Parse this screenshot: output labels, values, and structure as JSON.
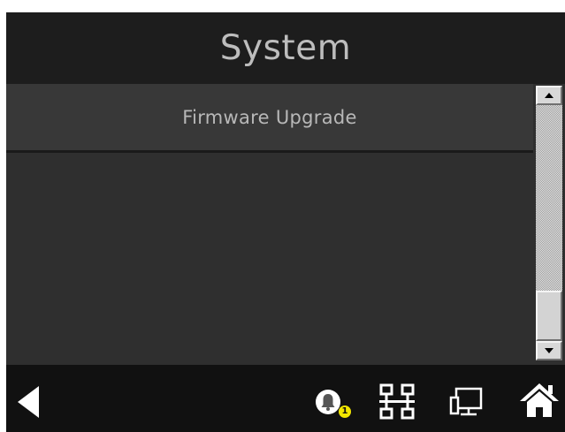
{
  "header": {
    "title": "System"
  },
  "list": {
    "items": [
      {
        "label": "Firmware Upgrade"
      }
    ]
  },
  "bottom_bar": {
    "alarm_badge_count": "1",
    "icons": [
      "back-arrow-icon",
      "alarm-bell-icon",
      "network-icon",
      "monitor-icon",
      "home-icon"
    ]
  },
  "colors": {
    "title_bar": "#1d1d1d",
    "content_background": "#2f2f2f",
    "list_item_background": "#383838",
    "bottom_bar": "#111111",
    "badge": "#f2e600",
    "icon": "#ffffff"
  }
}
